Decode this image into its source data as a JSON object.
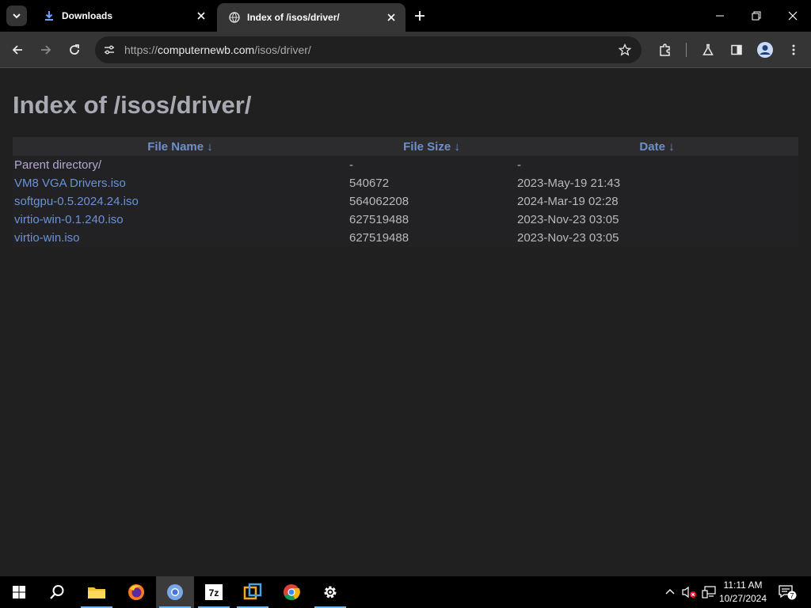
{
  "browser": {
    "tabs": [
      {
        "title": "Downloads",
        "active": false
      },
      {
        "title": "Index of /isos/driver/",
        "active": true
      }
    ],
    "url_scheme": "https://",
    "url_host": "computernewb.com",
    "url_path": "/isos/driver/"
  },
  "page": {
    "heading": "Index of /isos/driver/",
    "columns": [
      "File Name  ↓",
      "File Size  ↓",
      "Date  ↓"
    ],
    "rows": [
      {
        "name": "Parent directory/",
        "size": "-",
        "date": "-"
      },
      {
        "name": "VM8 VGA Drivers.iso",
        "size": "540672",
        "date": "2023-May-19 21:43"
      },
      {
        "name": "softgpu-0.5.2024.24.iso",
        "size": "564062208",
        "date": "2024-Mar-19 02:28"
      },
      {
        "name": "virtio-win-0.1.240.iso",
        "size": "627519488",
        "date": "2023-Nov-23 03:05"
      },
      {
        "name": "virtio-win.iso",
        "size": "627519488",
        "date": "2023-Nov-23 03:05"
      }
    ]
  },
  "taskbar": {
    "apps": [
      "start-icon",
      "search-icon",
      "file-explorer-icon",
      "firefox-icon",
      "chromium-icon",
      "7zip-icon",
      "vmware-icon",
      "chrome-icon",
      "settings-icon"
    ],
    "clock_time": "11:11 AM",
    "clock_date": "10/27/2024",
    "notification_count": "7"
  },
  "colors": {
    "link": "#6a92d6",
    "header_link": "#6f8fca",
    "heading": "#a9a9b3"
  }
}
